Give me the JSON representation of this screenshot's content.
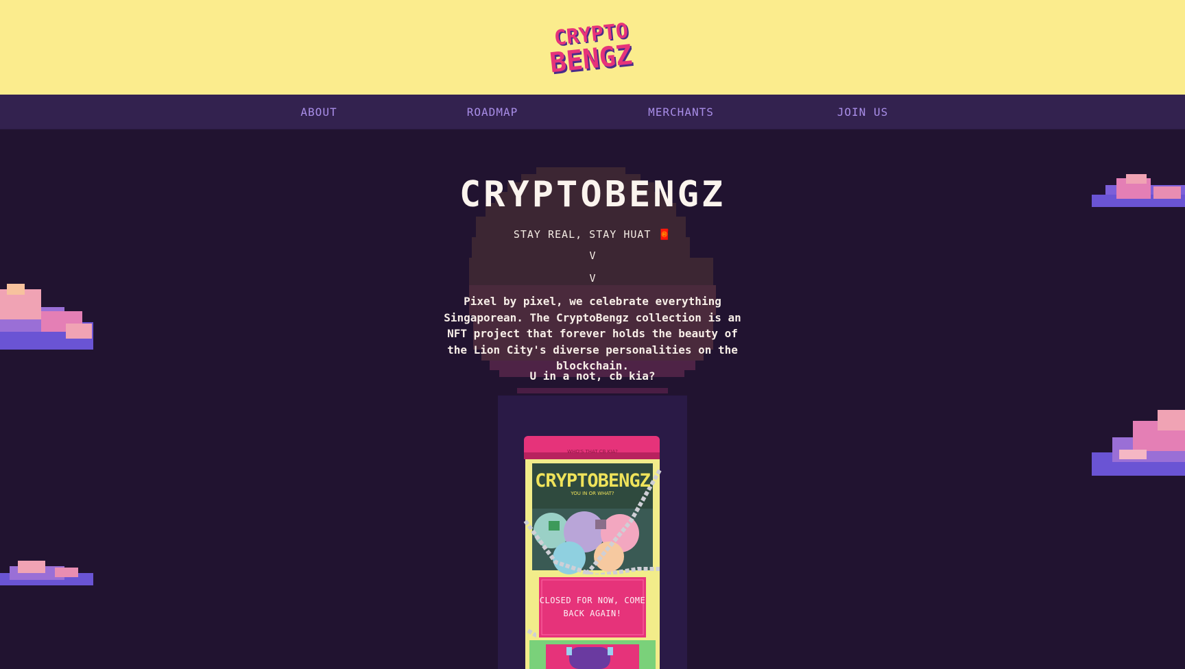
{
  "header": {
    "logo_line1": "CRYPTO",
    "logo_line2": "BENGZ",
    "logo_alt": "CryptoBengz logo"
  },
  "nav": {
    "items": [
      {
        "label": "ABOUT"
      },
      {
        "label": "ROADMAP"
      },
      {
        "label": "MERCHANTS"
      },
      {
        "label": "JOIN US"
      }
    ]
  },
  "hero": {
    "title": "CRYPTOBENGZ",
    "tagline": "STAY REAL, STAY HUAT 🧧",
    "chevron": "V",
    "description": "Pixel by pixel, we celebrate everything Singaporean. The CryptoBengz collection is an NFT project that forever holds the beauty of the Lion City's diverse personalities on the blockchain.",
    "question": "U in a not, cb kia?"
  },
  "machine": {
    "top_label": "WHO'S THAT CB KIA?",
    "brand": "CRYPTOBENGZ",
    "sub": "YOU IN OR WHAT?",
    "sign": "CLOSED FOR NOW, COME BACK AGAIN!"
  },
  "colors": {
    "background": "#211330",
    "topbar": "#fbec8d",
    "nav": "#33224f",
    "nav_text": "#a98ee8",
    "accent_pink": "#e6337a"
  }
}
